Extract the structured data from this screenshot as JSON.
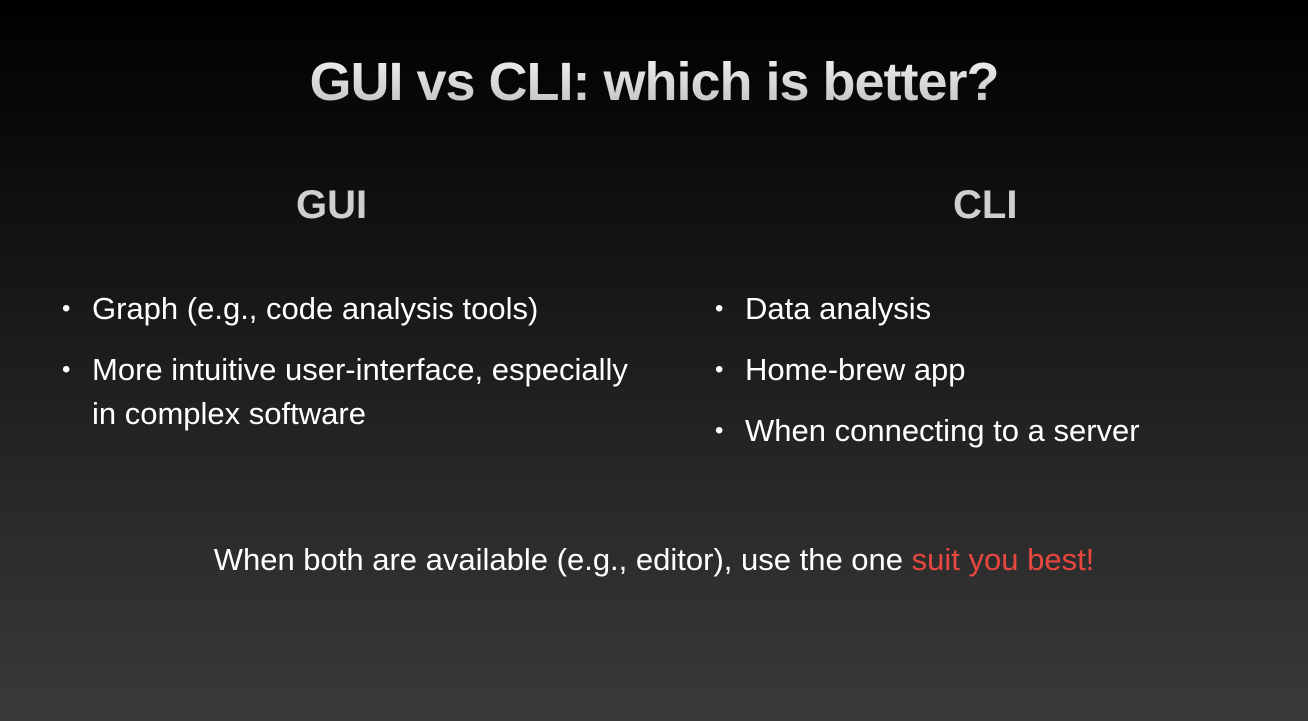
{
  "title": "GUI vs CLI: which is better?",
  "columns": {
    "gui": {
      "heading": "GUI",
      "items": [
        "Graph (e.g., code analysis tools)",
        "More intuitive user-interface, especially in complex software"
      ]
    },
    "cli": {
      "heading": "CLI",
      "items": [
        "Data analysis",
        "Home-brew app",
        "When connecting to a server"
      ]
    }
  },
  "footer": {
    "text": "When both are available (e.g., editor), use the one ",
    "highlight": "suit you best!"
  },
  "colors": {
    "accent": "#e8473f",
    "heading": "#cfcfcf"
  }
}
